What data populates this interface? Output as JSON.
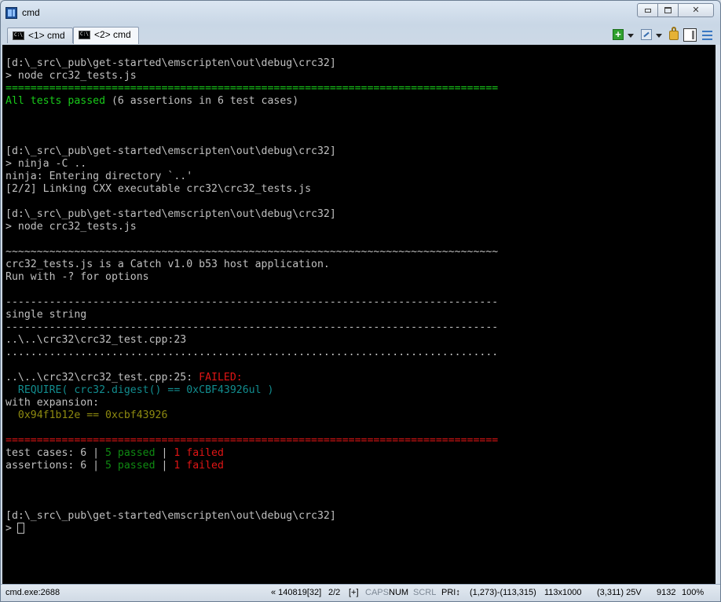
{
  "window": {
    "title": "cmd"
  },
  "window_controls": {
    "minimize": "",
    "maximize": "",
    "close": "✕"
  },
  "tabs": [
    {
      "label": "<1> cmd",
      "active": false
    },
    {
      "label": "<2> cmd",
      "active": true
    }
  ],
  "tab_icon_text": "C:\\",
  "toolbar": {
    "add_label": "+"
  },
  "console": {
    "lines": [
      {
        "segments": [
          {
            "text": "[d:\\_src\\_pub\\get-started\\emscripten\\out\\debug\\crc32]",
            "color": "default"
          }
        ]
      },
      {
        "segments": [
          {
            "text": "> node crc32_tests.js",
            "color": "default"
          }
        ]
      },
      {
        "segments": [
          {
            "text": "===============================================================================",
            "color": "green"
          }
        ]
      },
      {
        "segments": [
          {
            "text": "All tests passed",
            "color": "green"
          },
          {
            "text": " (6 assertions in 6 test cases)",
            "color": "default"
          }
        ]
      },
      {
        "segments": []
      },
      {
        "segments": []
      },
      {
        "segments": []
      },
      {
        "segments": [
          {
            "text": "[d:\\_src\\_pub\\get-started\\emscripten\\out\\debug\\crc32]",
            "color": "default"
          }
        ]
      },
      {
        "segments": [
          {
            "text": "> ninja -C ..",
            "color": "default"
          }
        ]
      },
      {
        "segments": [
          {
            "text": "ninja: Entering directory `..'",
            "color": "default"
          }
        ]
      },
      {
        "segments": [
          {
            "text": "[2/2] Linking CXX executable crc32\\crc32_tests.js",
            "color": "default"
          }
        ]
      },
      {
        "segments": []
      },
      {
        "segments": [
          {
            "text": "[d:\\_src\\_pub\\get-started\\emscripten\\out\\debug\\crc32]",
            "color": "default"
          }
        ]
      },
      {
        "segments": [
          {
            "text": "> node crc32_tests.js",
            "color": "default"
          }
        ]
      },
      {
        "segments": []
      },
      {
        "segments": [
          {
            "text": "~~~~~~~~~~~~~~~~~~~~~~~~~~~~~~~~~~~~~~~~~~~~~~~~~~~~~~~~~~~~~~~~~~~~~~~~~~~~~~~",
            "color": "default"
          }
        ]
      },
      {
        "segments": [
          {
            "text": "crc32_tests.js is a Catch v1.0 b53 host application.",
            "color": "default"
          }
        ]
      },
      {
        "segments": [
          {
            "text": "Run with -? for options",
            "color": "default"
          }
        ]
      },
      {
        "segments": []
      },
      {
        "segments": [
          {
            "text": "-------------------------------------------------------------------------------",
            "color": "default"
          }
        ]
      },
      {
        "segments": [
          {
            "text": "single string",
            "color": "default"
          }
        ]
      },
      {
        "segments": [
          {
            "text": "-------------------------------------------------------------------------------",
            "color": "default"
          }
        ]
      },
      {
        "segments": [
          {
            "text": "..\\..\\crc32\\crc32_test.cpp:23",
            "color": "default"
          }
        ]
      },
      {
        "segments": [
          {
            "text": "...............................................................................",
            "color": "default"
          }
        ]
      },
      {
        "segments": []
      },
      {
        "segments": [
          {
            "text": "..\\..\\crc32\\crc32_test.cpp:25: ",
            "color": "default"
          },
          {
            "text": "FAILED:",
            "color": "red"
          }
        ]
      },
      {
        "segments": [
          {
            "text": "  REQUIRE( crc32.digest() == 0xCBF43926ul )",
            "color": "teal"
          }
        ]
      },
      {
        "segments": [
          {
            "text": "with expansion:",
            "color": "default"
          }
        ]
      },
      {
        "segments": [
          {
            "text": "  0x94f1b12e == 0xcbf43926",
            "color": "olive"
          }
        ]
      },
      {
        "segments": []
      },
      {
        "segments": [
          {
            "text": "===============================================================================",
            "color": "red"
          }
        ]
      },
      {
        "segments": [
          {
            "text": "test cases: 6 | ",
            "color": "default"
          },
          {
            "text": "5 passed",
            "color": "darkgreen"
          },
          {
            "text": " | ",
            "color": "default"
          },
          {
            "text": "1 failed",
            "color": "red"
          }
        ]
      },
      {
        "segments": [
          {
            "text": "assertions: 6 | ",
            "color": "default"
          },
          {
            "text": "5 passed",
            "color": "darkgreen"
          },
          {
            "text": " | ",
            "color": "default"
          },
          {
            "text": "1 failed",
            "color": "red"
          }
        ]
      },
      {
        "segments": []
      },
      {
        "segments": []
      },
      {
        "segments": []
      },
      {
        "segments": [
          {
            "text": "[d:\\_src\\_pub\\get-started\\emscripten\\out\\debug\\crc32]",
            "color": "default"
          }
        ]
      },
      {
        "segments": [
          {
            "text": "> ",
            "color": "default"
          }
        ]
      }
    ]
  },
  "colors": {
    "default": "#c0c0c0",
    "green": "#19cb1a",
    "darkgreen": "#0f8a12",
    "red": "#e01515",
    "teal": "#128c8e",
    "olive": "#8e8a10",
    "console_bg": "#000000"
  },
  "status": {
    "process": "cmd.exe:2688",
    "build": "« 140819[32]",
    "tab_index": "2/2",
    "plus": "[+]",
    "caps": "CAPS",
    "num": "NUM",
    "scrl": "SCRL",
    "pri": "PRI↕",
    "selection": "(1,273)-(113,315)",
    "size": "113x1000",
    "cursor_pos": "(3,311) 25V",
    "pid": "9132",
    "zoom": "100%"
  }
}
